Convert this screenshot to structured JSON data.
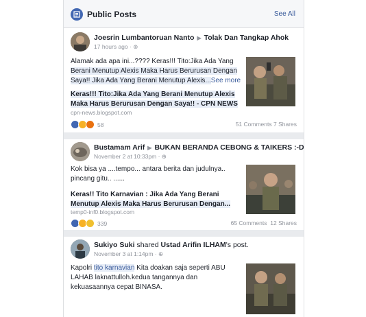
{
  "header": {
    "title": "Public Posts",
    "see_all": "See All"
  },
  "posts": [
    {
      "author": "Joesrin Lumbantoruan Nanto",
      "target": "Tolak Dan Tangkap Ahok",
      "time": "17 hours ago",
      "text_line1": "Alamak ada apa ini...???? Keras!!! Tito:Jika Ada Yang",
      "text_line2": "Berani Menutup Alexis Maka Harus Berurusan Dengan",
      "text_line3": "Saya!! Jika Ada Yang Berani Menutup Alexis...",
      "see_more": "See more",
      "link_title_line1": "Keras!!! Tito:Jika Ada Yang Berani Menutup Alexis",
      "link_title_line2": "Maka Harus Berurusan Dengan Saya!! - CPN NEWS",
      "link_url": "cpn-news.blogspot.com",
      "reactions": "58",
      "stats": "51 Comments 7 Shares"
    },
    {
      "author": "Bustamam Arif",
      "target": "BUKAN BERANDA CEBONG & TAIKERS :-D",
      "time": "November 2 at 10:33pm",
      "text_line1": "Kok bisa ya ....tempo... antara berita dan judulnya..",
      "text_line2": "pincang gitu.. ......",
      "link_title_line1": "Keras!! Tito Karnavian : Jika Ada Yang Berani",
      "link_title_line2": "Menutup Alexis Maka Harus Berurusan Dengan...",
      "link_url": "temp0-inf0.blogspot.com",
      "reactions": "339",
      "stats_comments": "65 Comments",
      "stats_shares": "12 Shares"
    },
    {
      "author": "Sukiyo Suki",
      "shared": "shared",
      "original": "Ustad Arifin ILHAM",
      "post_suffix": "'s post.",
      "time": "November 3 at 1:14pm",
      "text_line1_a": "Kapolri ",
      "text_line1_tag": "tito karnavian",
      "text_line1_b": " Kita doakan saja seperti ABU",
      "text_line2": "LAHAB laknattulloh.kedua tangannya dan",
      "text_line3": "kekuasaannya cepat BINASA."
    }
  ]
}
